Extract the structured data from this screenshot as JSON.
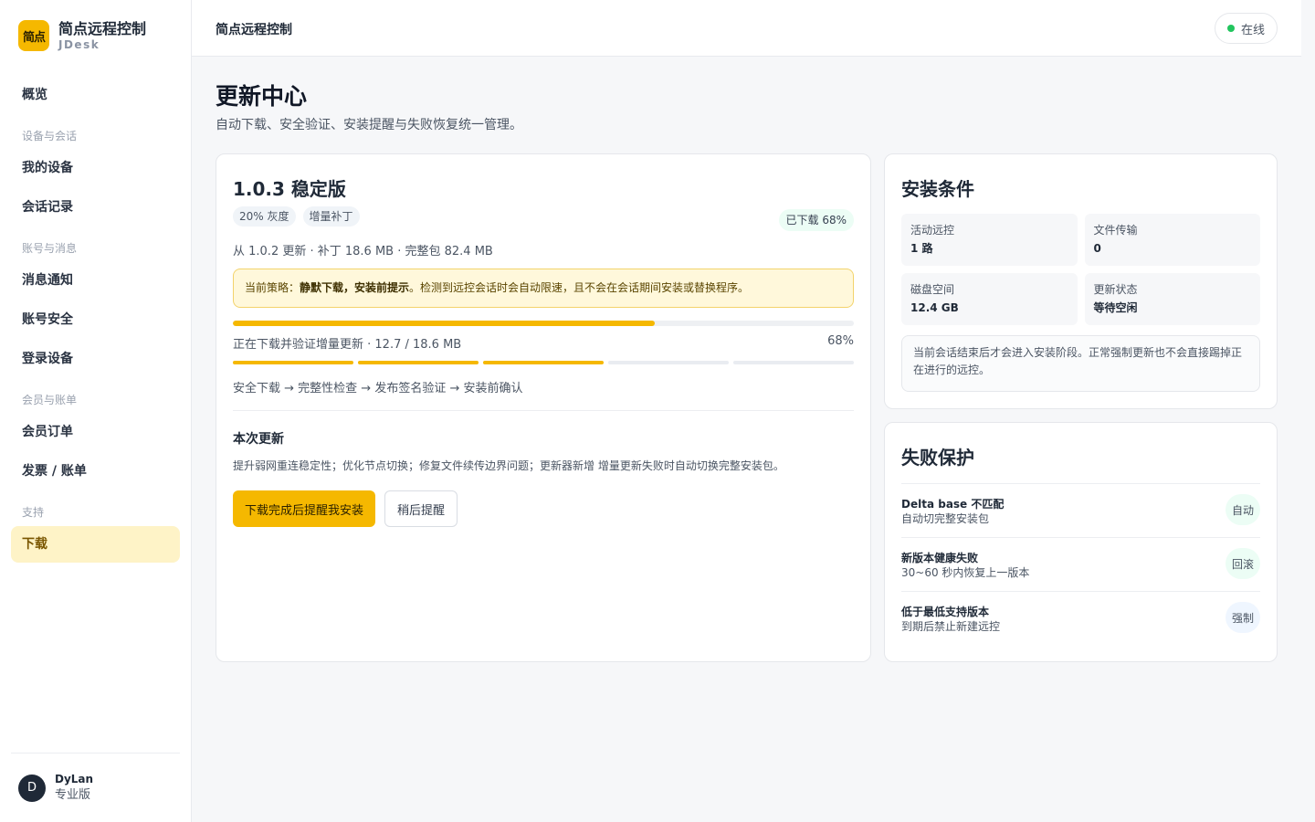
{
  "brand": {
    "logo_text": "简点",
    "name": "简点远程控制",
    "sub": "JDesk"
  },
  "nav": {
    "overview": "概览",
    "group_devices": "设备与会话",
    "my_devices": "我的设备",
    "sessions": "会话记录",
    "group_account": "账号与消息",
    "notifications": "消息通知",
    "security": "账号安全",
    "login_devices": "登录设备",
    "group_member": "会员与账单",
    "orders": "会员订单",
    "invoices": "发票 / 账单",
    "group_support": "支持",
    "download": "下载"
  },
  "user": {
    "initial": "D",
    "name": "DyLan",
    "plan": "专业版"
  },
  "topbar": {
    "title": "简点远程控制",
    "status": "在线"
  },
  "page": {
    "title": "更新中心",
    "subtitle": "自动下载、安全验证、安装提醒与失败恢复统一管理。"
  },
  "update": {
    "version_title": "1.0.3 稳定版",
    "tags": [
      "20% 灰度",
      "增量补丁"
    ],
    "downloaded_badge": "已下载 68%",
    "meta": "从 1.0.2 更新 · 补丁 18.6 MB · 完整包 82.4 MB",
    "policy_prefix": "当前策略：",
    "policy_bold": "静默下载，安装前提示",
    "policy_rest": "。检测到远控会话时会自动限速，且不会在会话期间安装或替换程序。",
    "progress_pct": 68,
    "progress_text": "正在下载并验证增量更新 · 12.7 / 18.6 MB",
    "progress_pct_label": "68%",
    "steps_done": 3,
    "steps_total": 5,
    "steps_label": "安全下载 → 完整性检查 → 发布签名验证 → 安装前确认",
    "notes_title": "本次更新",
    "notes_body": "提升弱网重连稳定性；优化节点切换；修复文件续传边界问题；更新器新增 增量更新失败时自动切换完整安装包。",
    "btn_primary": "下载完成后提醒我安装",
    "btn_secondary": "稍后提醒"
  },
  "conditions": {
    "title": "安装条件",
    "items": [
      {
        "label": "活动远控",
        "value": "1 路"
      },
      {
        "label": "文件传输",
        "value": "0"
      },
      {
        "label": "磁盘空间",
        "value": "12.4 GB"
      },
      {
        "label": "更新状态",
        "value": "等待空闲"
      }
    ],
    "note": "当前会话结束后才会进入安装阶段。正常强制更新也不会直接踢掉正在进行的远控。"
  },
  "failsafe": {
    "title": "失败保护",
    "rows": [
      {
        "title": "Delta base 不匹配",
        "desc": "自动切完整安装包",
        "badge": "自动"
      },
      {
        "title": "新版本健康失败",
        "desc": "30~60 秒内恢复上一版本",
        "badge": "回滚"
      },
      {
        "title": "低于最低支持版本",
        "desc": "到期后禁止新建远控",
        "badge": "强制"
      }
    ]
  },
  "colors": {
    "accent": "#f5b800",
    "online": "#22c55e"
  }
}
